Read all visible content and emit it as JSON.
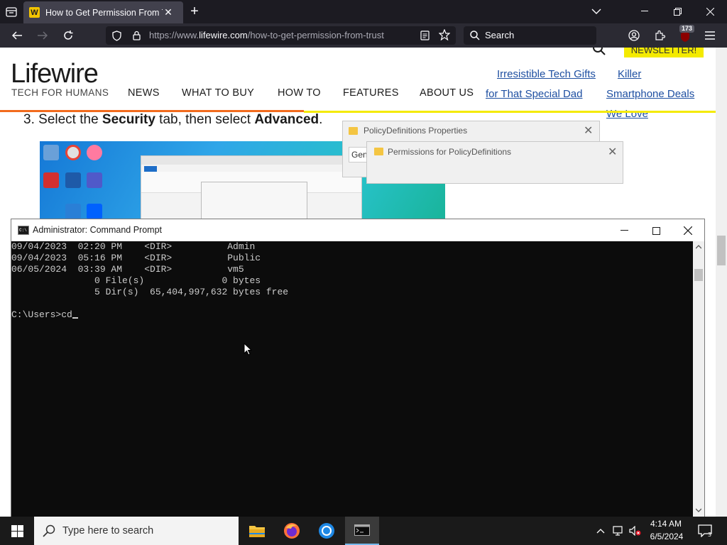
{
  "browser": {
    "tab_title": "How to Get Permission From Tr",
    "tab_favicon_letter": "W",
    "url_prefix": "https://www.",
    "url_host": "lifewire.com",
    "url_path": "/how-to-get-permission-from-trust",
    "search_placeholder": "Search",
    "notification_count": "173"
  },
  "site": {
    "logo": "Lifewire",
    "tagline": "TECH FOR HUMANS",
    "nav": [
      "NEWS",
      "WHAT TO BUY",
      "HOW TO",
      "FEATURES",
      "ABOUT US"
    ],
    "newsletter": "NEWSLETTER!",
    "promo1_line1": "Irresistible Tech Gifts",
    "promo1_line2": "for That Special Dad",
    "promo2_line1": "Killer",
    "promo2_line2": "Smartphone Deals",
    "promo2_line3": "We Love"
  },
  "article": {
    "step_number": "3.",
    "step_pre": "Select the ",
    "step_bold1": "Security",
    "step_mid": " tab, then select ",
    "step_bold2": "Advanced",
    "step_end": "."
  },
  "image_windows": {
    "properties_title": "PolicyDefinitions Properties",
    "permissions_title": "Permissions for PolicyDefinitions",
    "gen_tab": "Gen"
  },
  "cmd": {
    "title": "Administrator: Command Prompt",
    "lines": [
      "09/04/2023  02:20 PM    <DIR>          Admin",
      "09/04/2023  05:16 PM    <DIR>          Public",
      "06/05/2024  03:39 AM    <DIR>          vm5",
      "               0 File(s)              0 bytes",
      "               5 Dir(s)  65,404,997,632 bytes free",
      "",
      "C:\\Users>cd"
    ]
  },
  "taskbar": {
    "search_placeholder": "Type here to search",
    "time": "4:14 AM",
    "date": "6/5/2024"
  }
}
